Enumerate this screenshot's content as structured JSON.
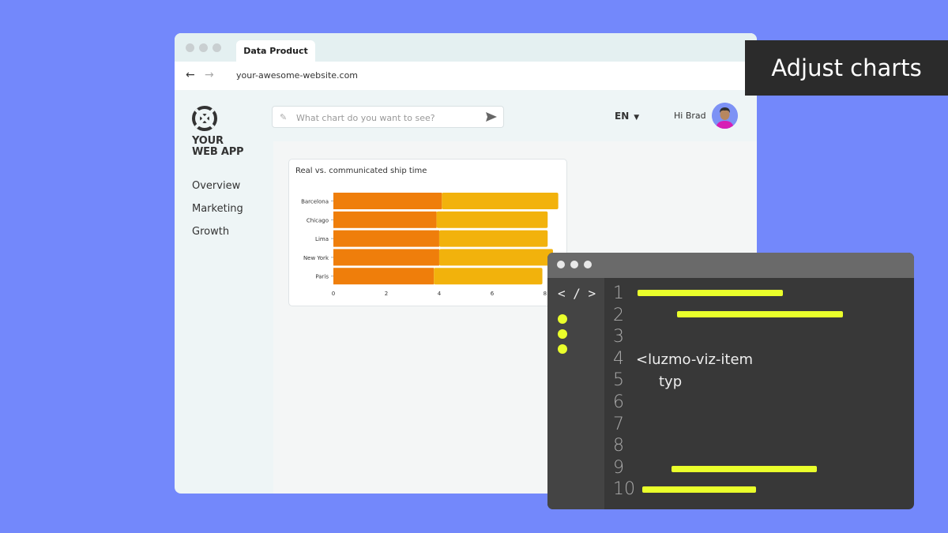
{
  "browser": {
    "tab_title": "Data Product",
    "url": "your-awesome-website.com",
    "back_glyph": "←",
    "forward_glyph": "→"
  },
  "app": {
    "logo_line1": "YOUR",
    "logo_line2": "WEB APP",
    "nav": [
      {
        "label": "Overview"
      },
      {
        "label": "Marketing"
      },
      {
        "label": "Growth"
      }
    ],
    "search": {
      "placeholder": "What chart do you want to see?"
    },
    "language": "EN",
    "greeting": "Hi Brad"
  },
  "chart_data": {
    "type": "bar",
    "orientation": "horizontal",
    "stacked": true,
    "title": "Real vs. communicated ship time",
    "categories": [
      "Barcelona",
      "Chicago",
      "Lima",
      "New York",
      "Paris"
    ],
    "series": [
      {
        "values": [
          4.1,
          3.9,
          4.0,
          4.0,
          3.8
        ]
      },
      {
        "values": [
          4.4,
          4.2,
          4.1,
          4.3,
          4.1
        ]
      }
    ],
    "colors": [
      "#ef7e0b",
      "#f2b20c"
    ],
    "xticks": [
      0,
      2,
      4,
      6,
      8
    ],
    "xlim": [
      0,
      8.6
    ]
  },
  "editor": {
    "code_icon": "< / >",
    "line_numbers": [
      "1",
      "2",
      "3",
      "4",
      "5",
      "6",
      "7",
      "8",
      "9",
      "10"
    ],
    "line4_text": "<luzmo-viz-item",
    "line5_text": "typ"
  },
  "banner": {
    "text": "Adjust charts"
  },
  "colors": {
    "background": "#7388fb",
    "accent_yellow": "#eaff2b",
    "editor_bg": "#383838",
    "banner_bg": "#2b2b2b"
  }
}
